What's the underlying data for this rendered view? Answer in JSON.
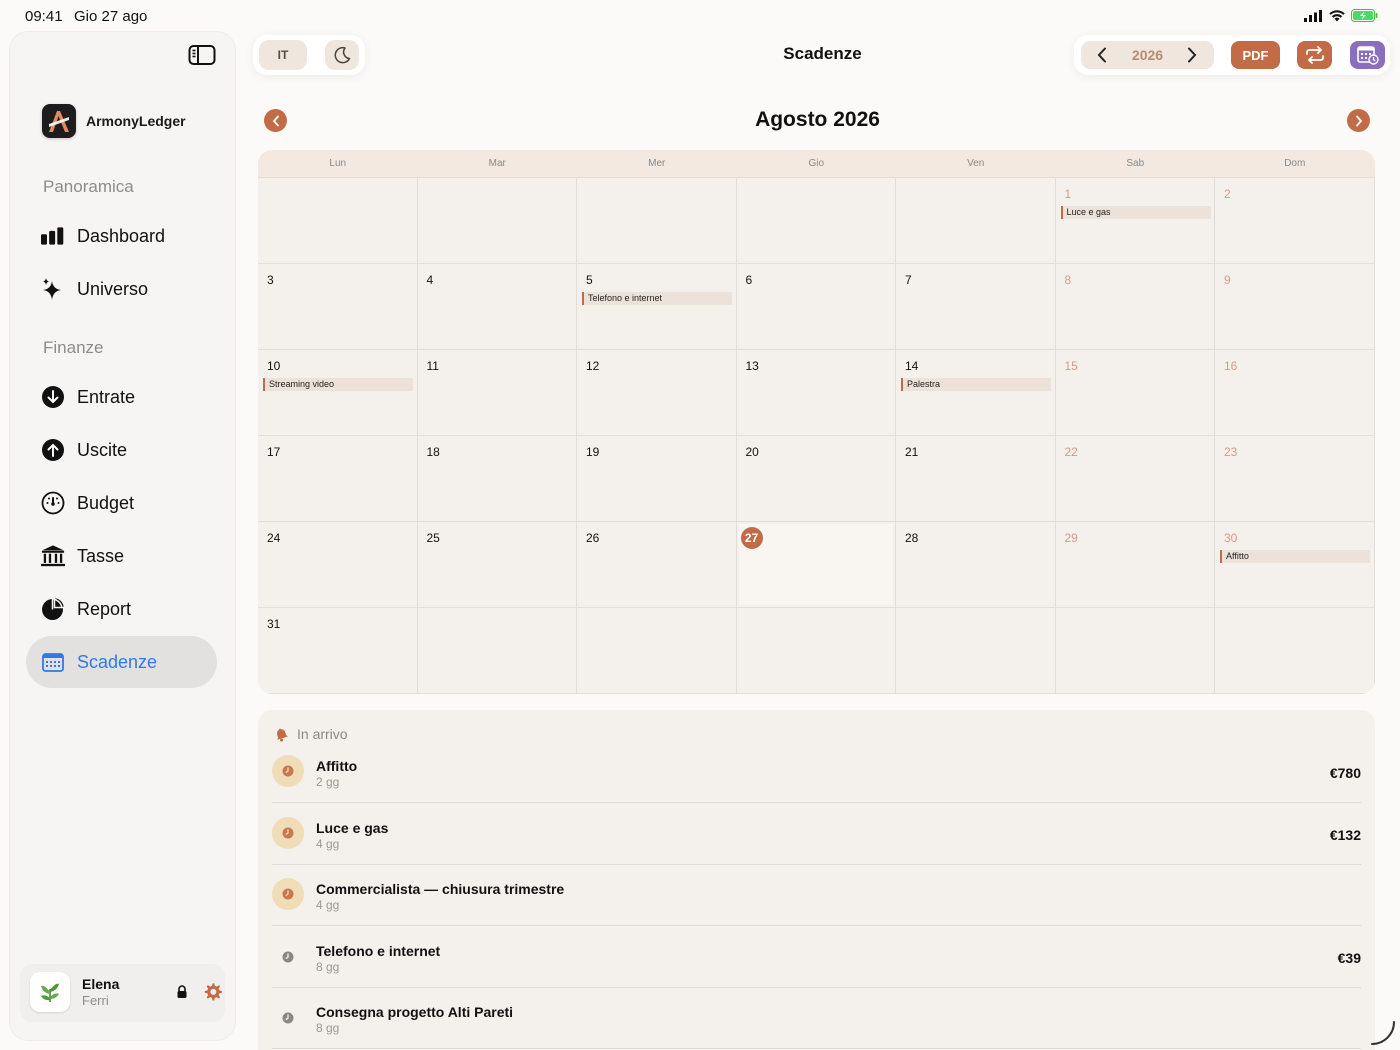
{
  "status_bar": {
    "time": "09:41",
    "date": "Gio 27 ago"
  },
  "sidebar": {
    "brand": "ArmonyLedger",
    "sections": [
      {
        "title": "Panoramica",
        "items": [
          {
            "label": "Dashboard",
            "icon": "chart-bars-icon"
          },
          {
            "label": "Universo",
            "icon": "sparkles-icon"
          }
        ]
      },
      {
        "title": "Finanze",
        "items": [
          {
            "label": "Entrate",
            "icon": "arrow-down-circle-icon"
          },
          {
            "label": "Uscite",
            "icon": "arrow-up-circle-icon"
          },
          {
            "label": "Budget",
            "icon": "gauge-icon"
          },
          {
            "label": "Tasse",
            "icon": "bank-icon"
          },
          {
            "label": "Report",
            "icon": "pie-chart-icon"
          },
          {
            "label": "Scadenze",
            "icon": "calendar-icon",
            "active": true
          }
        ]
      }
    ],
    "user": {
      "first_name": "Elena",
      "last_name": "Ferri"
    }
  },
  "toolbar": {
    "language": "IT",
    "page_title": "Scadenze",
    "year": "2026",
    "pdf_label": "PDF"
  },
  "calendar": {
    "month_title": "Agosto 2026",
    "weekdays": [
      "Lun",
      "Mar",
      "Mer",
      "Gio",
      "Ven",
      "Sab",
      "Dom"
    ],
    "weeks": [
      [
        {
          "day": ""
        },
        {
          "day": ""
        },
        {
          "day": ""
        },
        {
          "day": ""
        },
        {
          "day": ""
        },
        {
          "day": "1",
          "event": "Luce e gas"
        },
        {
          "day": "2"
        }
      ],
      [
        {
          "day": "3"
        },
        {
          "day": "4"
        },
        {
          "day": "5",
          "event": "Telefono e internet"
        },
        {
          "day": "6"
        },
        {
          "day": "7"
        },
        {
          "day": "8"
        },
        {
          "day": "9"
        }
      ],
      [
        {
          "day": "10",
          "event": "Streaming video"
        },
        {
          "day": "11"
        },
        {
          "day": "12"
        },
        {
          "day": "13"
        },
        {
          "day": "14",
          "event": "Palestra"
        },
        {
          "day": "15"
        },
        {
          "day": "16"
        }
      ],
      [
        {
          "day": "17"
        },
        {
          "day": "18"
        },
        {
          "day": "19"
        },
        {
          "day": "20"
        },
        {
          "day": "21"
        },
        {
          "day": "22"
        },
        {
          "day": "23"
        }
      ],
      [
        {
          "day": "24"
        },
        {
          "day": "25"
        },
        {
          "day": "26"
        },
        {
          "day": "27",
          "today": true
        },
        {
          "day": "28"
        },
        {
          "day": "29"
        },
        {
          "day": "30",
          "event": "Affitto"
        }
      ],
      [
        {
          "day": "31"
        },
        {
          "day": ""
        },
        {
          "day": ""
        },
        {
          "day": ""
        },
        {
          "day": ""
        },
        {
          "day": ""
        },
        {
          "day": ""
        }
      ]
    ],
    "accent_color": "#c16c47"
  },
  "upcoming": {
    "title": "In arrivo",
    "items": [
      {
        "name": "Affitto",
        "days": "2 gg",
        "amount": "€780",
        "highlight": true
      },
      {
        "name": "Luce e gas",
        "days": "4 gg",
        "amount": "€132",
        "highlight": true
      },
      {
        "name": "Commercialista — chiusura trimestre",
        "days": "4 gg",
        "amount": "",
        "highlight": true
      },
      {
        "name": "Telefono e internet",
        "days": "8 gg",
        "amount": "€39",
        "highlight": false
      },
      {
        "name": "Consegna progetto Alti Pareti",
        "days": "8 gg",
        "amount": "",
        "highlight": false
      }
    ]
  }
}
